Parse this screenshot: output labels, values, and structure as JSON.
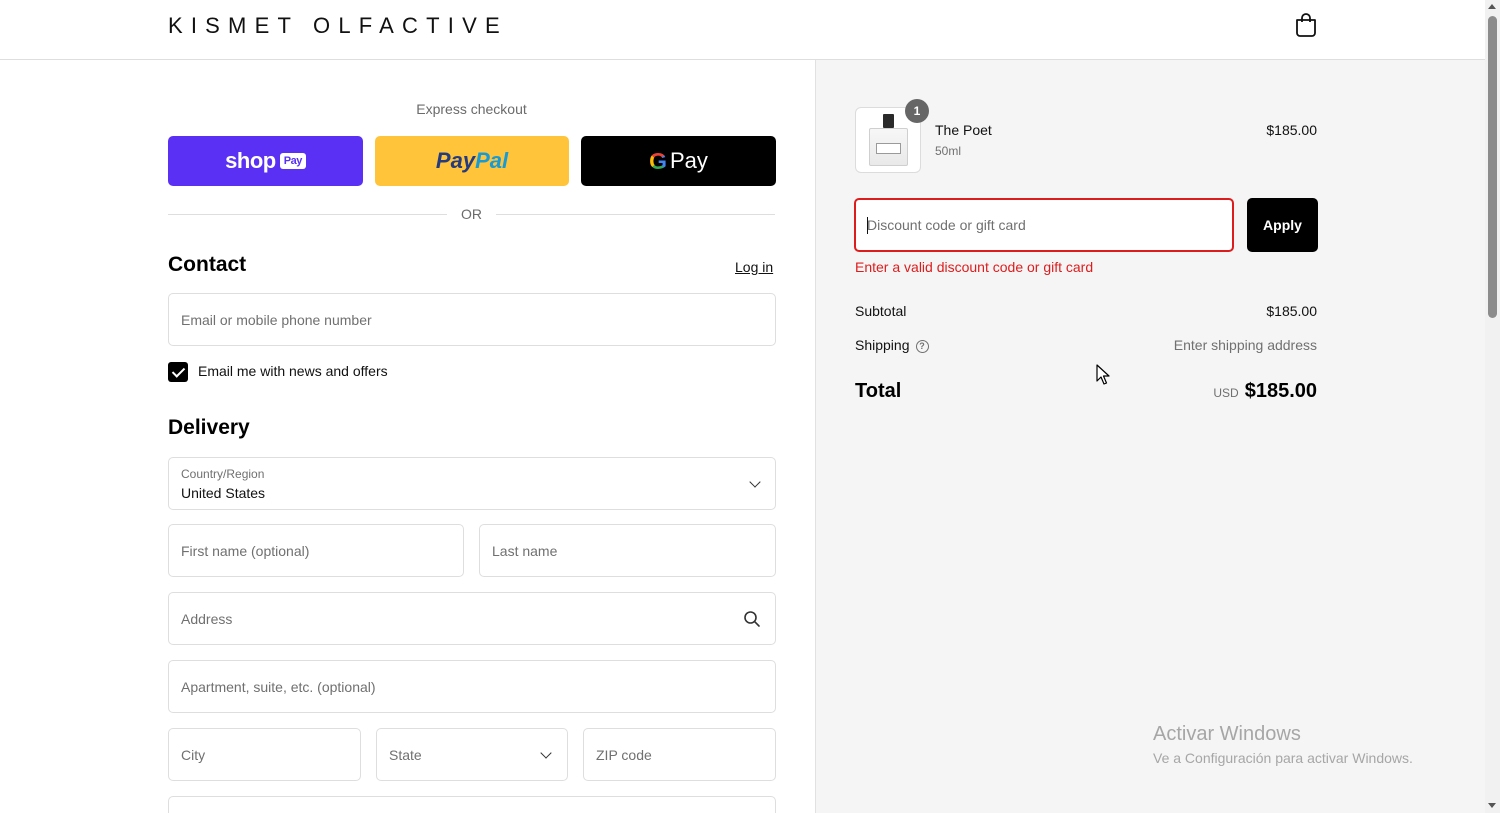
{
  "header": {
    "brand": "KISMET OLFACTIVE",
    "cart_icon": "shopping-bag-icon"
  },
  "express": {
    "title": "Express checkout",
    "shop_pay": {
      "word": "shop",
      "pill": "Pay",
      "color": "#5a31f4"
    },
    "paypal": {
      "part1": "Pay",
      "part2": "Pal",
      "color": "#ffc439"
    },
    "gpay": {
      "g": "G",
      "word": "Pay",
      "color": "#000000"
    },
    "divider": "OR"
  },
  "contact": {
    "title": "Contact",
    "login": "Log in",
    "email_placeholder": "Email or mobile phone number",
    "newsletter_label": "Email me with news and offers",
    "newsletter_checked": true
  },
  "delivery": {
    "title": "Delivery",
    "country_label": "Country/Region",
    "country_value": "United States",
    "first_name_placeholder": "First name (optional)",
    "last_name_placeholder": "Last name",
    "address_placeholder": "Address",
    "apartment_placeholder": "Apartment, suite, etc. (optional)",
    "city_placeholder": "City",
    "state_placeholder": "State",
    "zip_placeholder": "ZIP code"
  },
  "summary": {
    "item": {
      "name": "The Poet",
      "variant": "50ml",
      "price": "$185.00",
      "quantity": "1"
    },
    "discount_placeholder": "Discount code or gift card",
    "apply_label": "Apply",
    "discount_error": "Enter a valid discount code or gift card",
    "subtotal_label": "Subtotal",
    "subtotal_value": "$185.00",
    "shipping_label": "Shipping",
    "shipping_value": "Enter shipping address",
    "total_label": "Total",
    "total_currency": "USD",
    "total_value": "$185.00"
  },
  "watermark": {
    "line1": "Activar Windows",
    "line2": "Ve a Configuración para activar Windows."
  },
  "colors": {
    "error": "#dd1d1d",
    "accent": "#000000",
    "panel_bg": "#f5f5f5"
  }
}
